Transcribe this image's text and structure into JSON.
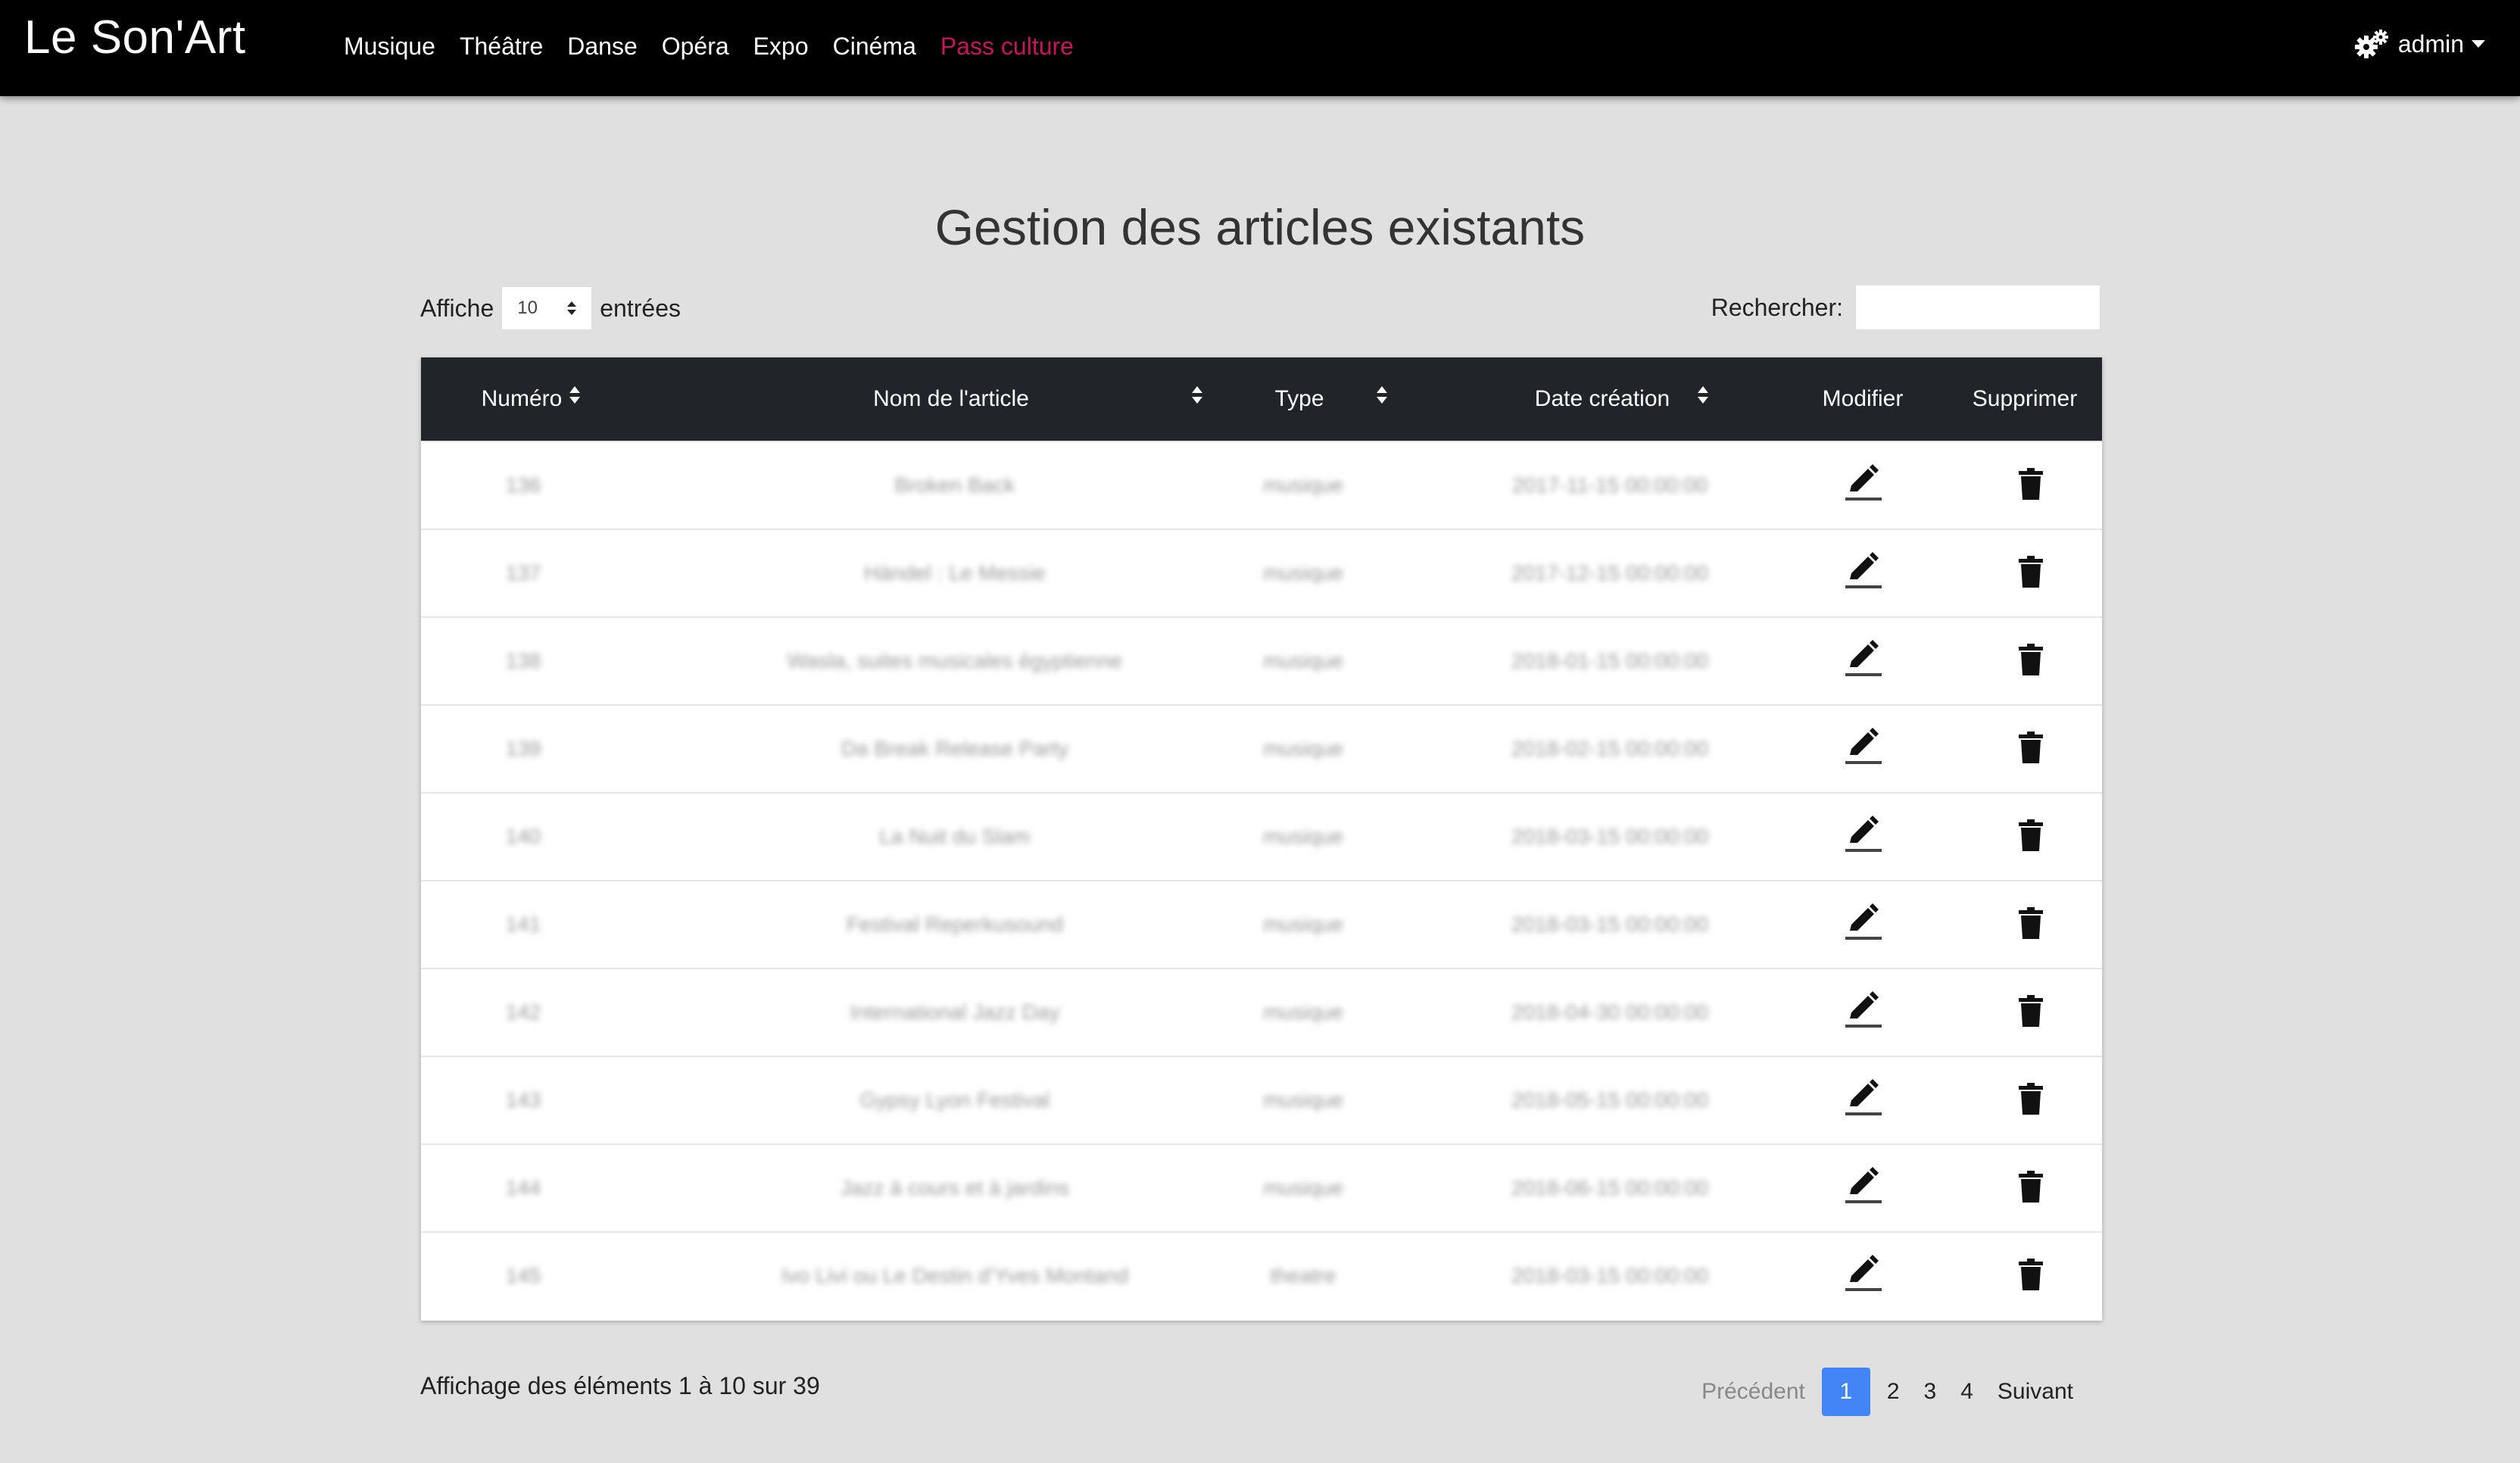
{
  "app": {
    "brand": "Le Son'Art"
  },
  "nav": {
    "items": [
      {
        "label": "Musique"
      },
      {
        "label": "Théâtre"
      },
      {
        "label": "Danse"
      },
      {
        "label": "Opéra"
      },
      {
        "label": "Expo"
      },
      {
        "label": "Cinéma"
      },
      {
        "label": "Pass culture"
      }
    ],
    "accent_color": "#c2185b"
  },
  "user": {
    "name": "admin",
    "icon": "gears-icon"
  },
  "page": {
    "title": "Gestion des articles existants"
  },
  "length": {
    "prefix": "Affiche",
    "value": "10",
    "suffix": "entrées"
  },
  "search": {
    "label": "Rechercher:",
    "value": ""
  },
  "table": {
    "headers": {
      "numero": "Numéro",
      "nom": "Nom de l'article",
      "type": "Type",
      "date": "Date création",
      "modifier": "Modifier",
      "supprimer": "Supprimer"
    },
    "rows": [
      {
        "numero": "136",
        "nom": "Broken Back",
        "type": "musique",
        "date": "2017-11-15 00:00:00"
      },
      {
        "numero": "137",
        "nom": "Händel : Le Messie",
        "type": "musique",
        "date": "2017-12-15 00:00:00"
      },
      {
        "numero": "138",
        "nom": "Wasla, suites musicales égyptienne",
        "type": "musique",
        "date": "2018-01-15 00:00:00"
      },
      {
        "numero": "139",
        "nom": "Da Break Release Party",
        "type": "musique",
        "date": "2018-02-15 00:00:00"
      },
      {
        "numero": "140",
        "nom": "La Nuit du Slam",
        "type": "musique",
        "date": "2018-03-15 00:00:00"
      },
      {
        "numero": "141",
        "nom": "Festival Reperkusound",
        "type": "musique",
        "date": "2018-03-15 00:00:00"
      },
      {
        "numero": "142",
        "nom": "International Jazz Day",
        "type": "musique",
        "date": "2018-04-30 00:00:00"
      },
      {
        "numero": "143",
        "nom": "Gypsy Lyon Festival",
        "type": "musique",
        "date": "2018-05-15 00:00:00"
      },
      {
        "numero": "144",
        "nom": "Jazz à cours et à jardins",
        "type": "musique",
        "date": "2018-06-15 00:00:00"
      },
      {
        "numero": "145",
        "nom": "Ivo Livi ou Le Destin d'Yves Montand",
        "type": "theatre",
        "date": "2018-03-15 00:00:00"
      }
    ]
  },
  "footer": {
    "info": "Affichage des éléments 1 à 10 sur 39",
    "prev": "Précédent",
    "pages": [
      "1",
      "2",
      "3",
      "4"
    ],
    "next": "Suivant",
    "active_color": "#4285f4"
  }
}
